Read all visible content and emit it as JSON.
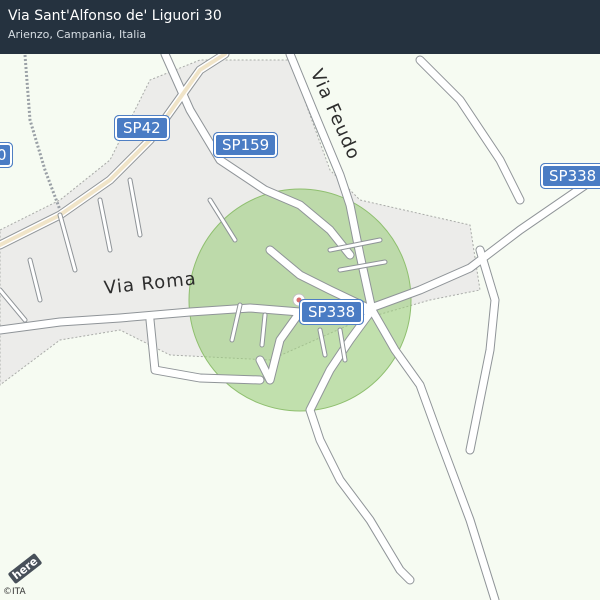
{
  "header": {
    "title": "Via Sant'Alfonso de' Liguori 30",
    "subtitle": "Arienzo, Campania, Italia"
  },
  "map": {
    "road_labels": {
      "via_roma": "Via  Roma",
      "via_feudo": "Via Feudo"
    },
    "route_shields": {
      "sp42": "SP42",
      "sp159": "SP159",
      "sp338_center": "SP338",
      "sp338_right": "SP338",
      "cut_left": "0"
    },
    "accuracy_circle_color": "#9fcf7f",
    "land_color": "#f6fbf2",
    "road_color": "#ffffff",
    "road_casing_color": "#8f9498",
    "shield_color": "#4a7cc4"
  },
  "footer": {
    "logo_text": "here",
    "copyright": "©ITA"
  }
}
